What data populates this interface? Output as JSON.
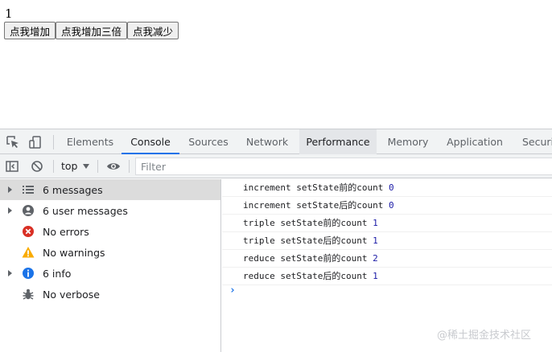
{
  "app": {
    "count": "1",
    "buttons": [
      "点我增加",
      "点我增加三倍",
      "点我减少"
    ]
  },
  "devtools": {
    "tabs": [
      "Elements",
      "Console",
      "Sources",
      "Network",
      "Performance",
      "Memory",
      "Application",
      "Securi"
    ],
    "active_tab": "Console",
    "toolbar": {
      "context": "top",
      "filter_placeholder": "Filter"
    },
    "sidebar": [
      {
        "label": "6 messages",
        "icon": "list-icon"
      },
      {
        "label": "6 user messages",
        "icon": "user-icon"
      },
      {
        "label": "No errors",
        "icon": "error-icon"
      },
      {
        "label": "No warnings",
        "icon": "warning-icon"
      },
      {
        "label": "6 info",
        "icon": "info-icon"
      },
      {
        "label": "No verbose",
        "icon": "bug-icon"
      }
    ],
    "logs": [
      {
        "text": "increment setState前的count",
        "value": "0"
      },
      {
        "text": "increment setState后的count",
        "value": "0"
      },
      {
        "text": "triple setState前的count",
        "value": "1"
      },
      {
        "text": "triple setState后的count",
        "value": "1"
      },
      {
        "text": "reduce setState前的count",
        "value": "2"
      },
      {
        "text": "reduce setState后的count",
        "value": "1"
      }
    ],
    "prompt": "›"
  },
  "watermark": "@稀土掘金技术社区",
  "colors": {
    "accent": "#1a73e8",
    "error": "#d93025",
    "warning": "#f9ab00",
    "info": "#1a73e8",
    "number": "#1a1aa6"
  }
}
